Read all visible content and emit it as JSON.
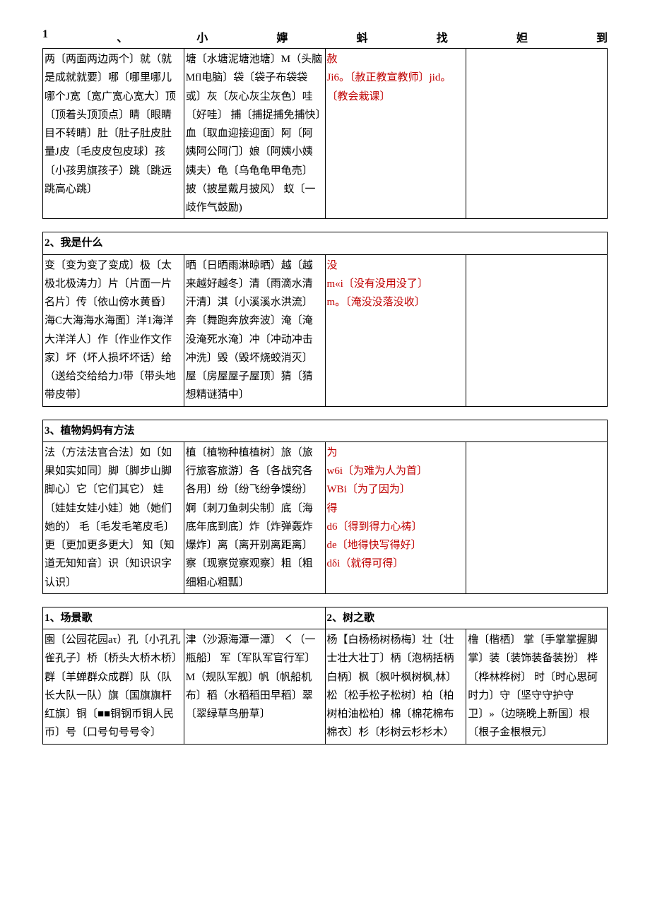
{
  "heading": [
    "1",
    "、",
    "小",
    "嬣",
    "蚪",
    "找",
    "妲",
    "到"
  ],
  "t1": {
    "c1": "两〔两面两边两个〕就（就是成就就要〕哪〔哪里哪儿哪个J宽〔宽广宽心宽大〕顶〔顶着头顶顶点〕睛〔眼睛目不转睛〕肚〔肚子肚皮肚量J皮〔毛皮皮包皮球〕孩〔小孩男旗孩子）跳〔跳远跳高心跳〕",
    "c2": "塘〔水塘泥塘池塘〕M（头脑Mfl电脑〕袋〔袋子布袋袋或〕灰〔灰心灰尘灰色〕哇〔好哇〕\n捕〔捕捉捕免捕快〕血〔取血迎接迎面〕阿〔阿姨阿公阿门〕娘〔阿姨小姨姨夫）龟〔乌龟龟甲龟売〕披（披星戴月披风）\n蚁〔一歧作气鼓励)",
    "c3r1": "赦",
    "c3r2": "Ji6。〔赦正教宣教师〕jid。",
    "c3r3": "〔教会栽课〕"
  },
  "t2": {
    "title": "2、我是什么",
    "c1": "变〔变为变了变成〕极〔太极北极涛力〕片〔片面一片名片〕传〔依山傍水黄昏〕海C大海海水海面〕洋1海洋大洋洋人〕作〔作业作文作家〕坏（坏人损坏坏话）给（送给交给给力J带〔带头地带皮带〕",
    "c2": "晒〔日晒雨淋晾晒）越〔越来越好越冬〕清〔雨滴水清汗清〕淇〔小溪溪水洪流〕奔〔舞跑奔放奔波〕淹〔淹没淹死水淹〕冲〔冲动冲击冲洗〕毁（毁坏烧蛟消灭〕屋〔房屋屋子屋顶〕猜〔猜想精谜猜中〕",
    "c3r1": "没",
    "c3r2": "m«i〔没有没用没了〕",
    "c3r3": "m。〔淹没没落没收〕"
  },
  "t3": {
    "title": "3、植物妈妈有方法",
    "c1": "法（方法法官合法〕如〔如果如实如同〕脚〔脚步山脚脚心〕它〔它们其它）\n娃〔娃娃女娃小娃〕她（她们她的）\n毛〔毛发毛笔皮毛〕更〔更加更多更大〕\n知〔知道无知知音〕识〔知识识字认识〕",
    "c2": "植〔植物种植植树〕旅（旅行旅客旅游〕各〔各战究各各用〕纷〔纷飞纷争馍纷〕婀〔刺刀鱼刺尖制〕底〔海底年底到底〕炸〔炸弹轰炸爆炸〕离〔离开别离距离〕察〔现察觉察观察〕粗〔粗细粗心粗瓢〕",
    "c3r1": "为",
    "c3r2": "w6i〔为难为人为首〕",
    "c3r3": "WBi〔为了因为〕",
    "c3r4": "得",
    "c3r5": "d6〔得到得力心祷〕",
    "c3r6": "de〔地得快写得好〕",
    "c3r7": "dδi（就得可得〕"
  },
  "t4": {
    "titleA": "1、场景歌",
    "titleB": "2、树之歌",
    "a1": "園〔公园花园aτ）孔〔小孔孔雀孔子〕桥〔桥头大桥木桥〕群〔羊蝉群众成群〕队（队长大队一队）旗〔国旗旗杆红旗〕铜〔■■铜钢币铜人民币〕号〔口号句号号令〕",
    "a2": "津（沙源海潭一潭〕\nく（一瓶船〕\n军〔军队军官行军〕\nM（规队军舰〕帆〔帆船机布〕稻（水稻稻田早稻〕翠〔翠绿草鸟册草〕",
    "b1": "杨【白杨杨树杨梅〕壮〔壮士壮大壮丁〕柄〔泡柄括柄白柄〕枫〔枫叶枫树枫,林〕松〔松手松子松树〕柏〔柏树柏油松柏〕棉〔棉花棉布棉衣〕杉〔杉树云杉杉木）",
    "b2": "橹〔楷栖〕\n掌〔手掌掌握脚掌〕装〔装饰装备装扮〕\n桦〔桦林桦树〕\n时〔时心思砢时力〕守〔坚守守护守卫〕»（边晓晚上新国〕根〔根子金根根元〕"
  }
}
